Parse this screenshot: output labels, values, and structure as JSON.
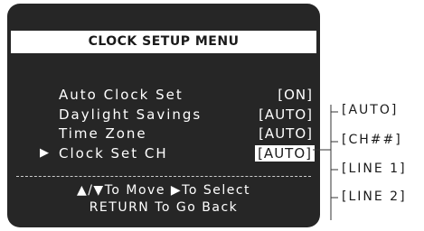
{
  "menu": {
    "title": "CLOCK SETUP MENU",
    "rows": [
      {
        "label": "Auto Clock Set",
        "value": "[ON]"
      },
      {
        "label": "Daylight Savings",
        "value": "[AUTO]"
      },
      {
        "label": "Time Zone",
        "value": "[AUTO]"
      },
      {
        "label": "Clock Set CH",
        "value": "[AUTO]"
      }
    ],
    "selected_row": 3,
    "pointer_glyph": "▶"
  },
  "help": {
    "line1": "▲/▼To Move  ▶To Select",
    "line2": "RETURN To Go Back"
  },
  "options": [
    "[AUTO]",
    "[CH##]",
    "[LINE 1]",
    "[LINE 2]"
  ],
  "colors": {
    "panel": "#262626",
    "text": "#ffffff",
    "highlight": "#ffffff"
  }
}
